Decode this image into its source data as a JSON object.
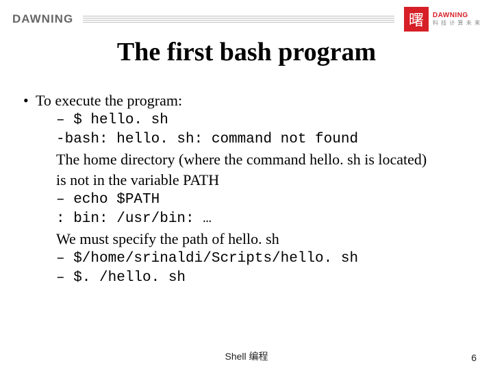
{
  "header": {
    "brand_left": "DAWNING",
    "brand_right_char": "曙",
    "brand_right_small1": "DAWNING",
    "brand_right_small2": "科 技 计 算 未 来"
  },
  "title": "The first bash program",
  "bullet": "To execute the program:",
  "lines": {
    "l1": "– $ hello. sh",
    "l2": "-bash: hello. sh: command not found",
    "l3a": "The home directory (where the command hello. sh is located)",
    "l3b": "is not in the variable PATH",
    "l4": "– echo $PATH",
    "l5": ": bin: /usr/bin: …",
    "l6": "We must specify the path of hello. sh",
    "l7": "– $/home/srinaldi/Scripts/hello. sh",
    "l8": "– $. /hello. sh"
  },
  "footer": "Shell 编程",
  "page": "6"
}
